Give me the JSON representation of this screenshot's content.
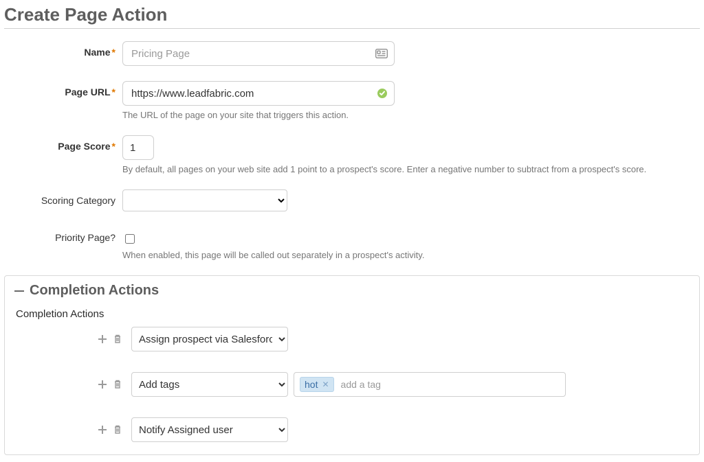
{
  "page": {
    "title": "Create Page Action"
  },
  "form": {
    "name": {
      "label": "Name",
      "required": true,
      "placeholder": "Pricing Page",
      "value": ""
    },
    "page_url": {
      "label": "Page URL",
      "required": true,
      "value": "https://www.leadfabric.com",
      "help": "The URL of the page on your site that triggers this action."
    },
    "page_score": {
      "label": "Page Score",
      "required": true,
      "value": "1",
      "help": "By default, all pages on your web site add 1 point to a prospect's score. Enter a negative number to subtract from a prospect's score."
    },
    "scoring_category": {
      "label": "Scoring Category",
      "value": ""
    },
    "priority_page": {
      "label": "Priority Page?",
      "checked": false,
      "help": "When enabled, this page will be called out separately in a prospect's activity."
    }
  },
  "completion_actions": {
    "section_title": "Completion Actions",
    "sub_label": "Completion Actions",
    "rows": [
      {
        "action": "Assign prospect via Salesforce a"
      },
      {
        "action": "Add tags",
        "tags": [
          "hot"
        ],
        "tag_placeholder": "add a tag"
      },
      {
        "action": "Notify Assigned user"
      }
    ]
  }
}
